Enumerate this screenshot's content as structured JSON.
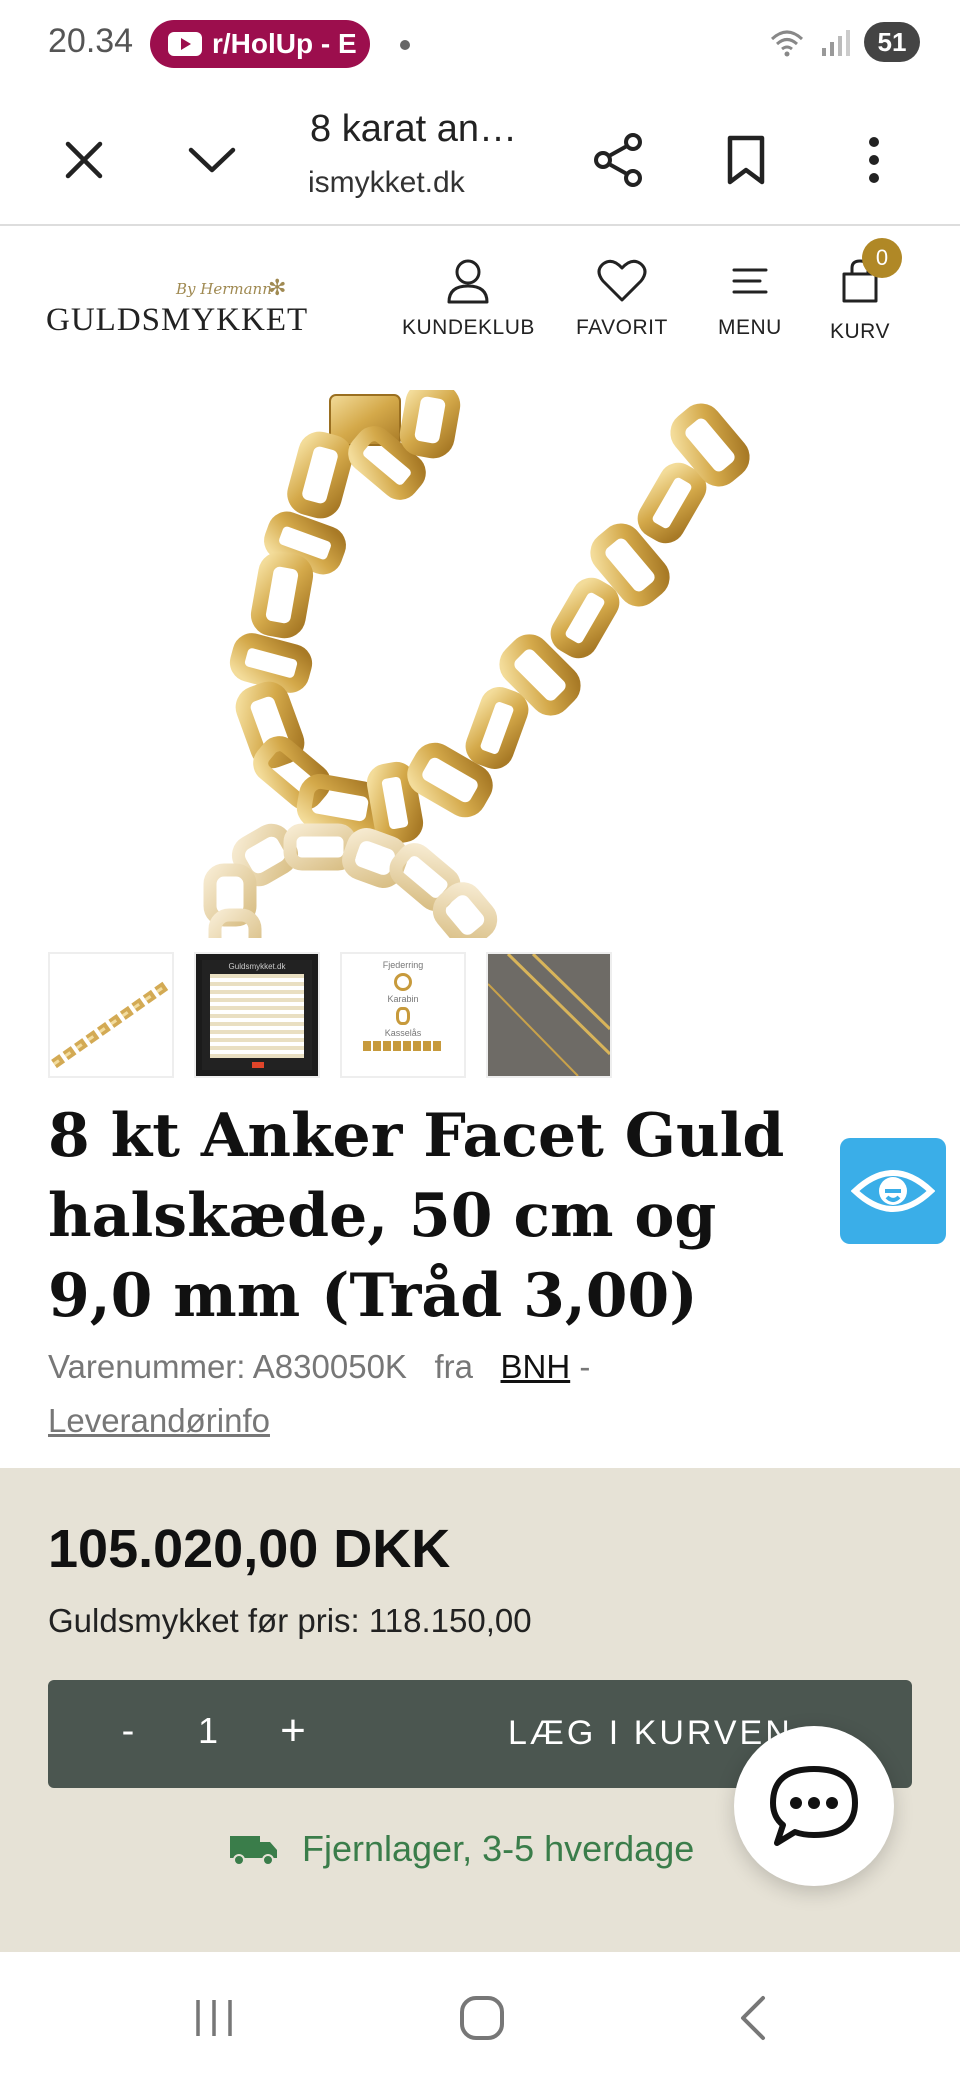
{
  "status_bar": {
    "time": "20.34",
    "notification_label": "r/HolUp - E",
    "battery": "51"
  },
  "toolbar": {
    "page_title": "8 karat an…",
    "url": "ismykket.dk"
  },
  "site_header": {
    "logo_tagline": "By Hermann",
    "logo_name": "GULDSMYKKET",
    "nav": {
      "kundeklub": "KUNDEKLUB",
      "favorit": "FAVORIT",
      "menu": "MENU",
      "kurv": "KURV"
    },
    "cart_count": "0"
  },
  "thumbnails": {
    "t3_label1": "Fjederring",
    "t3_label2": "Karabin",
    "t3_label3": "Kasselås",
    "t2_header": "Guldsmykket.dk"
  },
  "product": {
    "title": "8 kt Anker Facet Guld halskæde, 50 cm og 9,0 mm (Tråd 3,00)",
    "item_number_label": "Varenummer: A830050K",
    "from_label": "fra",
    "supplier": "BNH",
    "separator": "-",
    "supplier_info": "Leverandørinfo"
  },
  "pricing": {
    "price": "105.020,00 DKK",
    "before_price": "Guldsmykket før pris: 118.150,00",
    "qty_minus": "-",
    "quantity": "1",
    "qty_plus": "+",
    "add_to_cart": "LÆG I KURVEN",
    "stock_status": "Fjernlager, 3-5 hverdage"
  },
  "colors": {
    "accent_gold": "#b08826",
    "buy_bar": "#4b5650",
    "price_panel": "#e6e2d6",
    "stock_green": "#3a7d4a",
    "eye_widget": "#3aaee8"
  }
}
